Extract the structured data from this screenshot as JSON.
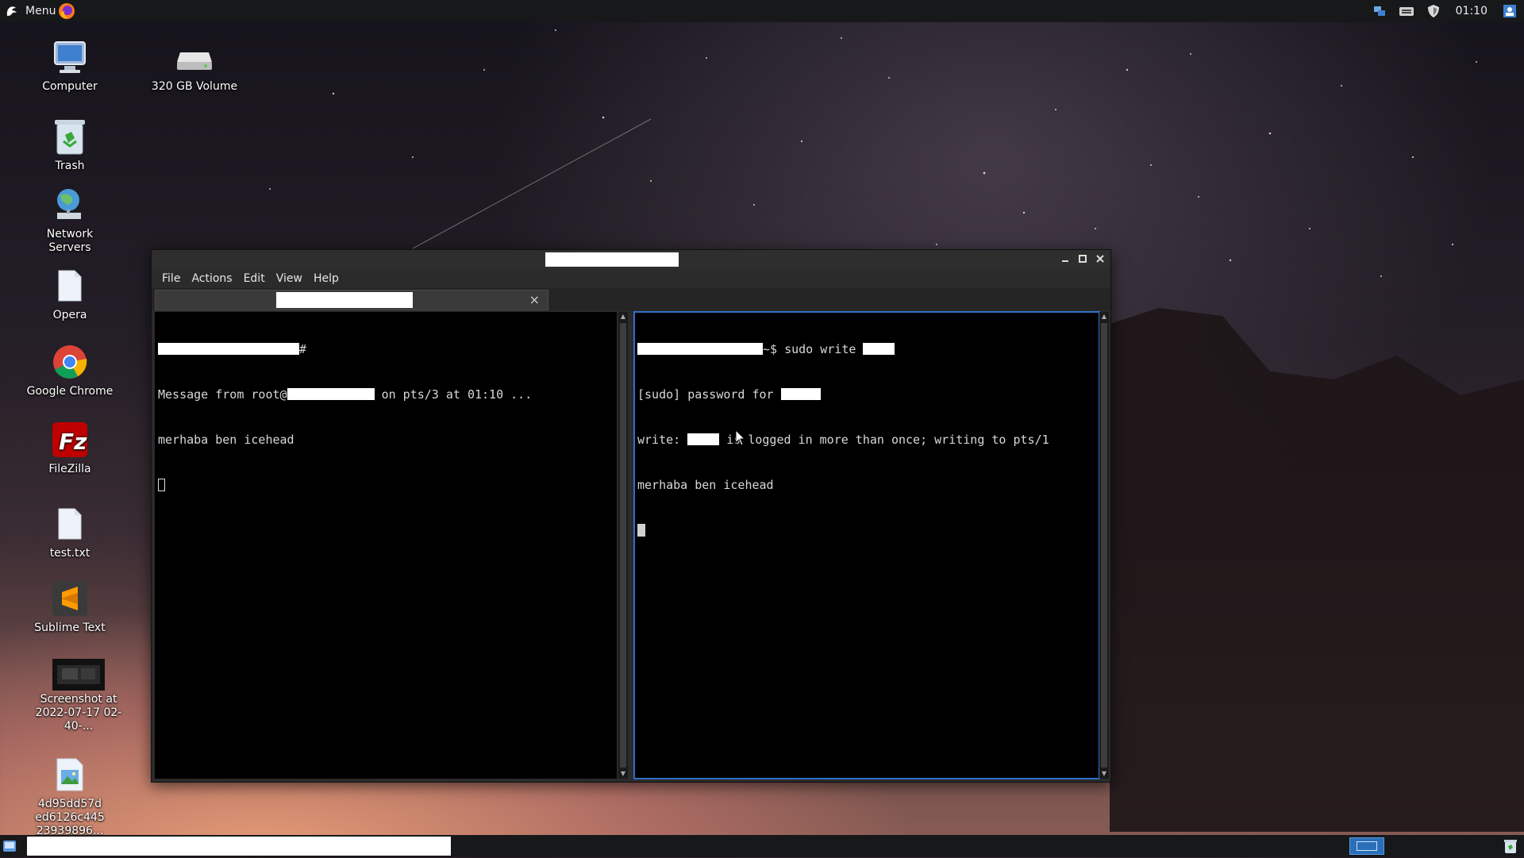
{
  "top_panel": {
    "menu_label": "Menu",
    "clock": "01:10",
    "icons": [
      "menu-logo-icon",
      "firefox-icon",
      "network-icon",
      "keyboard-icon",
      "shield-icon",
      "user-icon"
    ]
  },
  "desktop": {
    "icons": [
      {
        "label": "Computer",
        "icon": "computer-icon"
      },
      {
        "label": "320 GB Volume",
        "icon": "drive-icon"
      },
      {
        "label": "Trash",
        "icon": "trash-icon"
      },
      {
        "label": "Network Servers",
        "icon": "network-servers-icon"
      },
      {
        "label": "Opera",
        "icon": "file-icon"
      },
      {
        "label": "Google Chrome",
        "icon": "chrome-icon"
      },
      {
        "label": "FileZilla",
        "icon": "filezilla-icon"
      },
      {
        "label": "test.txt",
        "icon": "text-file-icon"
      },
      {
        "label": "Sublime Text",
        "icon": "sublime-icon"
      },
      {
        "label": "Screenshot at 2022-07-17 02-40-...",
        "icon": "screenshot-thumbnail"
      },
      {
        "label": "4d95dd57d ed6126c445 23939896...",
        "icon": "image-file-icon"
      }
    ]
  },
  "terminal": {
    "menus": [
      "File",
      "Actions",
      "Edit",
      "View",
      "Help"
    ],
    "tab_close": "×",
    "left_pane": {
      "prompt_suffix": "#",
      "msg_prefix": "Message from root@",
      "msg_suffix": " on pts/3 at 01:10 ...",
      "message": "merhaba ben icehead"
    },
    "right_pane": {
      "prompt_suffix": "~$ sudo write ",
      "sudo_prefix": "[sudo] password for ",
      "write_prefix": "write: ",
      "write_suffix": " is logged in more than once; writing to pts/1",
      "message": "merhaba ben icehead"
    }
  },
  "colors": {
    "focus_outline": "#2f6fc9",
    "workspace": "#2a6fb8"
  }
}
